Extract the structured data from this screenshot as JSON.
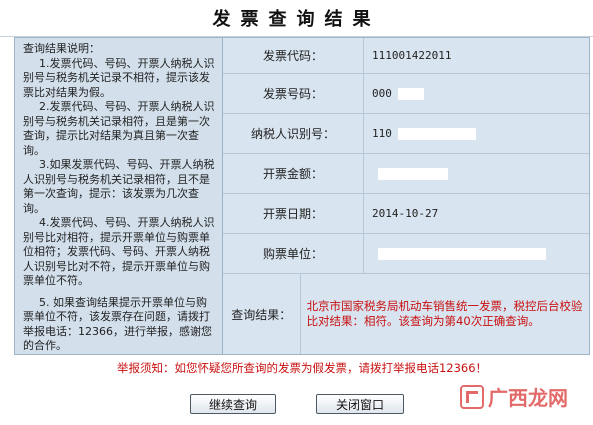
{
  "title": "发票查询结果",
  "explanation": {
    "heading": "查询结果说明：",
    "items": [
      "1.发票代码、号码、开票人纳税人识别号与税务机关记录不相符，提示该发票比对结果为假。",
      "2.发票代码、号码、开票人纳税人识别号与税务机关记录相符，且是第一次查询，提示比对结果为真且第一次查询。",
      "3.如果发票代码、号码、开票人纳税人识别号与税务机关记录相符，且不是第一次查询，提示：该发票为几次查询。",
      "4.发票代码、号码、开票人纳税人识别号比对相符，提示开票单位与购票单位相符；发票代码、号码、开票人纳税人识别号比对不符，提示开票单位与购票单位不符。",
      "5. 如果查询结果提示开票单位与购票单位不符，该发票存在问题，请拨打举报电话：12366，进行举报，感谢您的合作。"
    ]
  },
  "fields": {
    "invoice_code": {
      "label": "发票代码：",
      "value": "111001422011"
    },
    "invoice_number": {
      "label": "发票号码：",
      "value": "000"
    },
    "taxpayer_id": {
      "label": "纳税人识别号：",
      "value": "110"
    },
    "amount": {
      "label": "开票金额：",
      "value": ""
    },
    "date": {
      "label": "开票日期：",
      "value": "2014-10-27"
    },
    "buyer": {
      "label": "购票单位：",
      "value": ""
    },
    "result": {
      "label": "查询结果：",
      "value": "北京市国家税务局机动车销售统一发票，税控后台校验比对结果：相符。该查询为第40次正确查询。"
    }
  },
  "notice": "举报须知：如您怀疑您所查询的发票为假发票，请拨打举报电话12366！",
  "buttons": {
    "continue": "继续查询",
    "close": "关闭窗口"
  },
  "watermark": "广西龙网",
  "colors": {
    "accent_red": "#c81010",
    "panel_bg": "#d8e4ef",
    "border": "#9fb4c7"
  }
}
